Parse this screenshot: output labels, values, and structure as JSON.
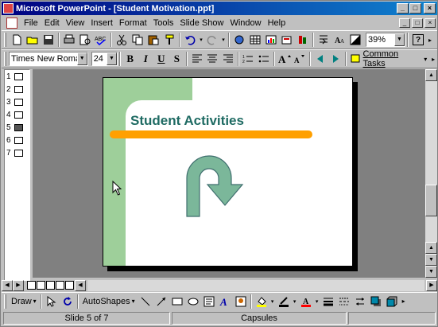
{
  "window": {
    "title": "Microsoft PowerPoint - [Student Motivation.ppt]",
    "title_buttons": [
      "_",
      "□",
      "×"
    ]
  },
  "menu": {
    "items": [
      "File",
      "Edit",
      "View",
      "Insert",
      "Format",
      "Tools",
      "Slide Show",
      "Window",
      "Help"
    ],
    "mdi_buttons": [
      "_",
      "□",
      "×"
    ]
  },
  "toolbar_standard": {
    "zoom": "39%",
    "help": "?"
  },
  "toolbar_formatting": {
    "font": "Times New Roman",
    "size": "24",
    "bold": "B",
    "italic": "I",
    "underline": "U",
    "shadow": "S",
    "common_tasks": "Common Tasks"
  },
  "outline": {
    "slides": [
      "1",
      "2",
      "3",
      "4",
      "5",
      "6",
      "7"
    ],
    "selected": "5"
  },
  "slide": {
    "title": "Student Activities"
  },
  "drawing": {
    "draw": "Draw",
    "autoshapes": "AutoShapes"
  },
  "status": {
    "slide": "Slide 5 of 7",
    "design": "Capsules"
  },
  "colors": {
    "title_bar": "#000080",
    "green_bar": "#9ecf9a",
    "orange_bar": "#ffa000",
    "title_text": "#1f6b63",
    "arrow_fill": "#7bb79a"
  }
}
